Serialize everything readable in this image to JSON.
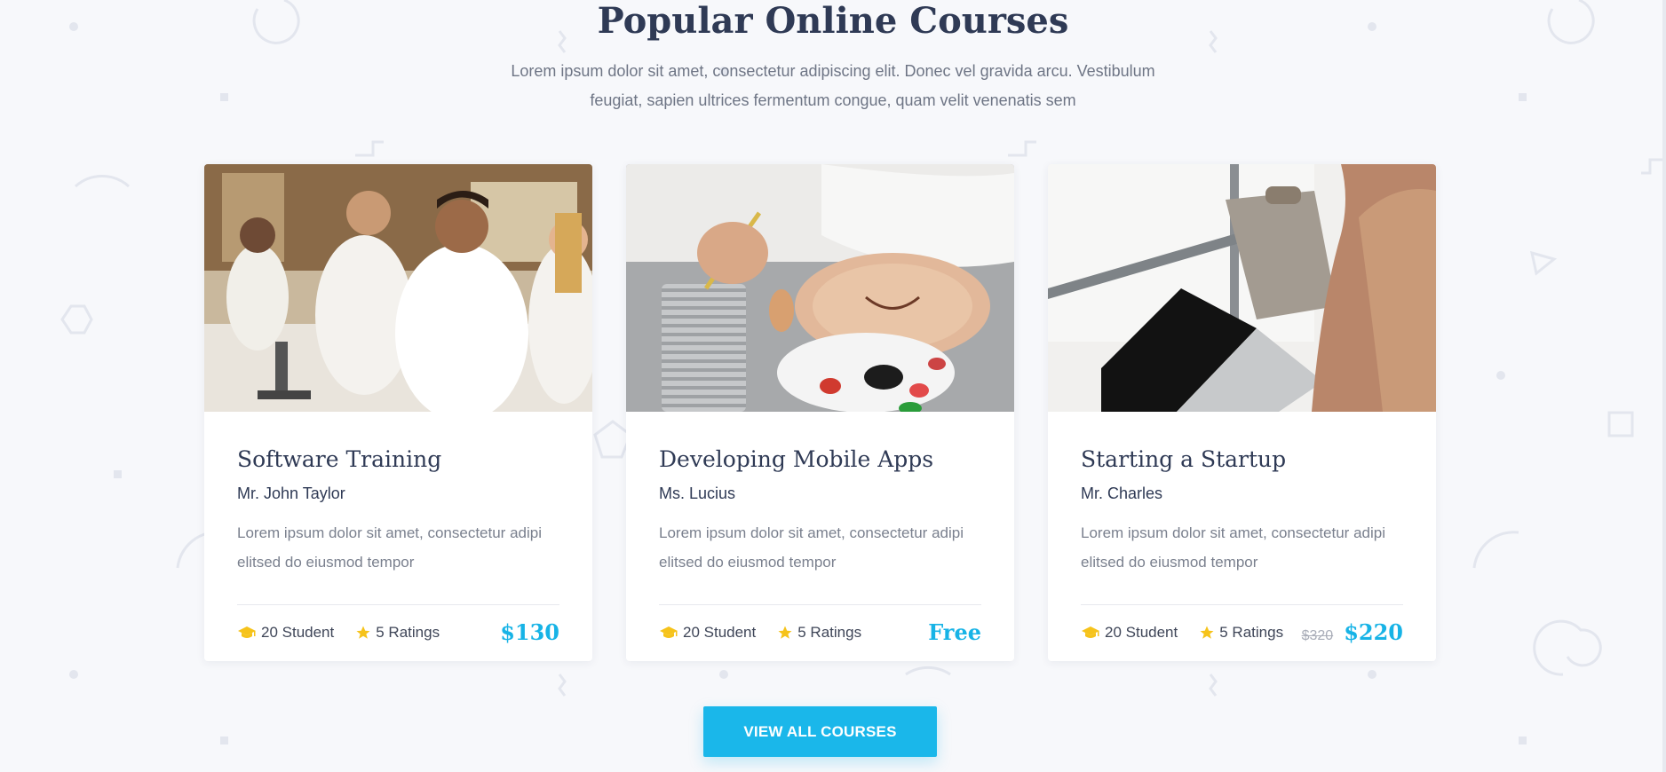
{
  "section": {
    "title": "Popular Online Courses",
    "subtitle_line1": "Lorem ipsum dolor sit amet, consectetur adipiscing elit. Donec vel gravida arcu. Vestibulum",
    "subtitle_line2": "feugiat, sapien ultrices fermentum congue, quam velit venenatis sem"
  },
  "courses": [
    {
      "title": "Software Training",
      "instructor": "Mr. John Taylor",
      "desc_line1": "Lorem ipsum dolor sit amet, consectetur adipi",
      "desc_line2": "elitsed do eiusmod tempor",
      "students": "20 Student",
      "ratings": "5 Ratings",
      "price": "$130",
      "old_price": ""
    },
    {
      "title": "Developing Mobile Apps",
      "instructor": "Ms. Lucius",
      "desc_line1": "Lorem ipsum dolor sit amet, consectetur adipi",
      "desc_line2": "elitsed do eiusmod tempor",
      "students": "20 Student",
      "ratings": "5 Ratings",
      "price": "Free",
      "old_price": ""
    },
    {
      "title": "Starting a Startup",
      "instructor": "Mr. Charles",
      "desc_line1": "Lorem ipsum dolor sit amet, consectetur adipi",
      "desc_line2": "elitsed do eiusmod tempor",
      "students": "20 Student",
      "ratings": "5 Ratings",
      "price": "$220",
      "old_price": "$320"
    }
  ],
  "cta": {
    "label": "VIEW ALL COURSES"
  },
  "icons": {
    "students": "graduation-cap-icon",
    "ratings": "star-icon"
  },
  "colors": {
    "accent": "#1ab7ea",
    "icon": "#f6c31b",
    "heading": "#2f3a55"
  }
}
